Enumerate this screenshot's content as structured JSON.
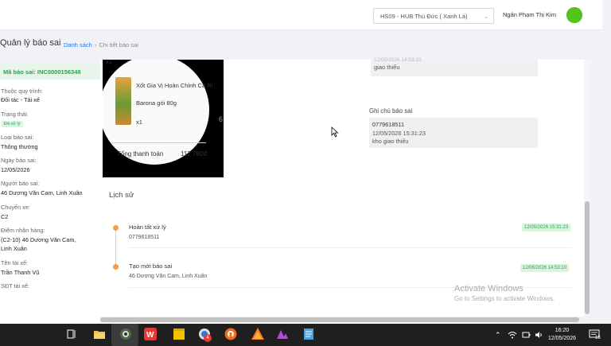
{
  "header": {
    "hub_select_value": "HS09 - HUB Thủ Đức ( Xanh Lá)",
    "user_name": "Ngân Phạm Thị Kim"
  },
  "page": {
    "title": "Quản lý báo sai",
    "breadcrumb": [
      "Danh sách",
      "Chi tiết báo sai"
    ]
  },
  "sidebar": {
    "code_label": "Mã báo sai: INC0000156348",
    "fields": [
      {
        "label": "Thuộc quy trình:",
        "value": "Đối tác - Tài xế"
      },
      {
        "label": "Trạng thái:",
        "value": "Đã xử lý"
      },
      {
        "label": "Loại báo sai:",
        "value": "Thông thường"
      },
      {
        "label": "Ngày báo sai:",
        "value": "12/05/2026"
      },
      {
        "label": "Người báo sai:",
        "value": "46 Dương Văn Cam, Linh Xuân"
      },
      {
        "label": "Chuyến xe:",
        "value": "C2"
      },
      {
        "label": "Điểm nhận hàng:",
        "value": "(C2-10) 46 Dương Văn Cam,",
        "value2": "Linh Xuân"
      },
      {
        "label": "Tên tài xế:",
        "value": "Trần Thanh Vũ"
      },
      {
        "label": "SĐT tài xế:",
        "value": ""
      }
    ]
  },
  "image": {
    "line1": "Xốt Gia Vị Hoàn Chỉnh Cà Ri",
    "line2": "Barona gói 80g",
    "qty_top": "x1",
    "qty": "x1",
    "side_number": "6",
    "total_label": "Tổng thanh toán",
    "total_value": "112.780đ"
  },
  "notes": {
    "top_faded": "12/05/2026 14:53:10",
    "top_text": "giao thiếu",
    "title": "Ghi chú báo sai",
    "phone": "0779618511",
    "time": "12/05/2026 15:31:23",
    "text": "kho giao thiếu"
  },
  "history": {
    "title": "Lịch sử",
    "items": [
      {
        "title": "Hoàn tất xử lý",
        "sub": "0779618511",
        "time": "12/05/2026 15:31:23"
      },
      {
        "title": "Tạo mới báo sai",
        "sub": "46 Dương Văn Cam, Linh Xuân",
        "time": "12/05/2026 14:53:10"
      }
    ]
  },
  "watermark": {
    "line1": "Activate Windows",
    "line2": "Go to Settings to activate Windows."
  },
  "taskbar": {
    "time": "16:20",
    "date": "12/05/2026",
    "chat_badge": "4",
    "notification_count": "15",
    "icons": [
      "task-view-icon",
      "file-explorer-icon",
      "camera-icon",
      "wps-office-icon",
      "sticky-notes-icon",
      "chat-icon",
      "brave-icon",
      "firefox-icon",
      "affinity-icon",
      "notepad-icon"
    ],
    "colors": {
      "explorer": "#f0c14b",
      "wps": "#e53935",
      "sticky": "#f2c200",
      "brave": "#f26a21",
      "notepad": "#4aa3df"
    }
  }
}
